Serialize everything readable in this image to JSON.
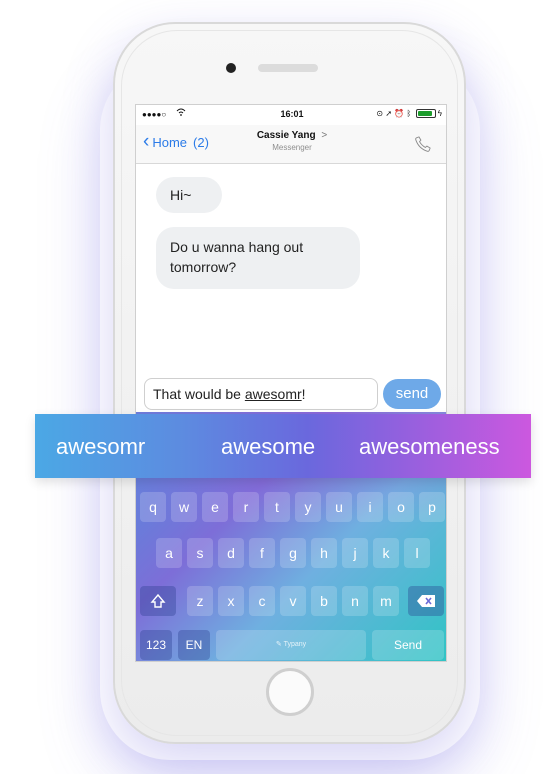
{
  "status_bar": {
    "signal": "●●●●○",
    "time": "16:01"
  },
  "nav": {
    "back_label": "Home",
    "back_count": "(2)",
    "contact_name": "Cassie Yang",
    "contact_chevron": ">",
    "subtitle": "Messenger"
  },
  "messages": [
    {
      "text": "Hi~"
    },
    {
      "text": "Do u wanna hang out tomorrow?"
    }
  ],
  "composer": {
    "text_before": "That would be ",
    "text_typo": "awesomr",
    "text_after": "!",
    "send_label": "send"
  },
  "suggestions": [
    "awesomr",
    "awesome",
    "awesomeness"
  ],
  "keyboard": {
    "row1": [
      "q",
      "w",
      "e",
      "r",
      "t",
      "y",
      "u",
      "i",
      "o",
      "p"
    ],
    "row2": [
      "a",
      "s",
      "d",
      "f",
      "g",
      "h",
      "j",
      "k",
      "l"
    ],
    "row3": [
      "z",
      "x",
      "c",
      "v",
      "b",
      "n",
      "m"
    ],
    "numbers_key": "123",
    "language_key": "EN",
    "space_label": "Typany",
    "send_key": "Send"
  },
  "icons": {
    "back": "chevron-left-icon",
    "call": "phone-icon",
    "shift": "shift-arrow-icon",
    "backspace": "backspace-icon"
  },
  "colors": {
    "accent": "#2b7be8",
    "send_pill": "#6ea9e8"
  }
}
